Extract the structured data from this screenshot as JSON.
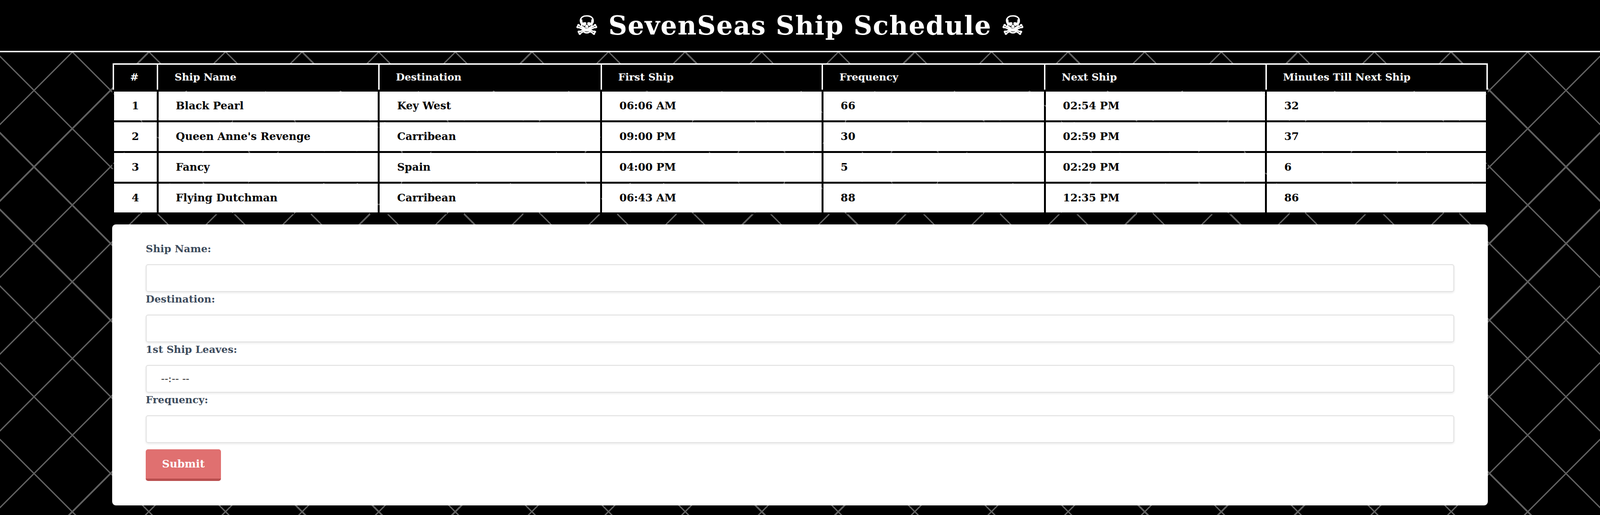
{
  "header": {
    "title": "☠ SevenSeas Ship Schedule ☠"
  },
  "table": {
    "columns": [
      "#",
      "Ship Name",
      "Destination",
      "First Ship",
      "Frequency",
      "Next Ship",
      "Minutes Till Next Ship"
    ],
    "rows": [
      [
        "1",
        "Black Pearl",
        "Key West",
        "06:06 AM",
        "66",
        "02:54 PM",
        "32"
      ],
      [
        "2",
        "Queen Anne's Revenge",
        "Carribean",
        "09:00 PM",
        "30",
        "02:59 PM",
        "37"
      ],
      [
        "3",
        "Fancy",
        "Spain",
        "04:00 PM",
        "5",
        "02:29 PM",
        "6"
      ],
      [
        "4",
        "Flying Dutchman",
        "Carribean",
        "06:43 AM",
        "88",
        "12:35 PM",
        "86"
      ]
    ]
  },
  "form": {
    "fields": [
      {
        "label": "Ship Name:",
        "placeholder": ""
      },
      {
        "label": "Destination:",
        "placeholder": ""
      },
      {
        "label": "1st Ship Leaves:",
        "placeholder": "--:-- --"
      },
      {
        "label": "Frequency:",
        "placeholder": ""
      }
    ],
    "submit": "Submit"
  }
}
